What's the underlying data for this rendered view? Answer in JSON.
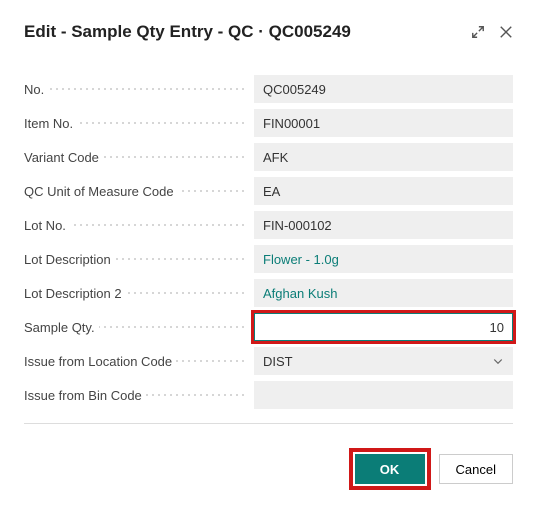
{
  "dialog": {
    "title": "Edit - Sample Qty Entry - QC · QC005249"
  },
  "fields": {
    "no": {
      "label": "No.",
      "value": "QC005249"
    },
    "item_no": {
      "label": "Item No.",
      "value": "FIN00001"
    },
    "variant_code": {
      "label": "Variant Code",
      "value": "AFK"
    },
    "qc_uom": {
      "label": "QC Unit of Measure Code",
      "value": "EA"
    },
    "lot_no": {
      "label": "Lot No.",
      "value": "FIN-000102"
    },
    "lot_desc": {
      "label": "Lot Description",
      "value": "Flower - 1.0g"
    },
    "lot_desc2": {
      "label": "Lot Description 2",
      "value": "Afghan Kush"
    },
    "sample_qty": {
      "label": "Sample Qty.",
      "value": "10"
    },
    "issue_loc": {
      "label": "Issue from Location Code",
      "value": "DIST"
    },
    "issue_bin": {
      "label": "Issue from Bin Code",
      "value": ""
    }
  },
  "buttons": {
    "ok": "OK",
    "cancel": "Cancel"
  }
}
